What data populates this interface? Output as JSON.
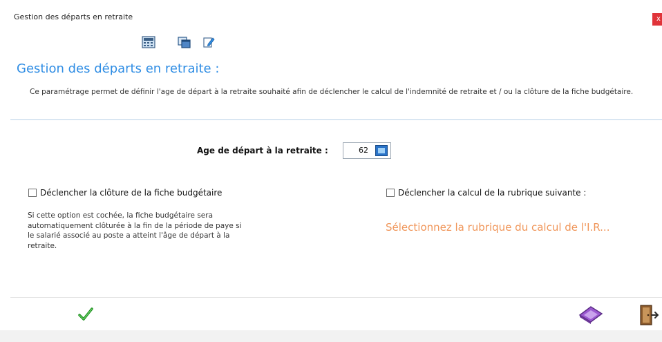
{
  "window": {
    "title": "Gestion des départs en retraite",
    "close_label": "x"
  },
  "toolbar": {
    "items": [
      {
        "icon": "calculator-icon"
      },
      {
        "icon": "windows-icon"
      },
      {
        "icon": "edit-icon"
      }
    ]
  },
  "main": {
    "heading": "Gestion des départs en retraite :",
    "description": "Ce paramétrage permet de définir l'age de départ à la retraite souhaité afin de déclencher le calcul de l'indemnité de retraite et / ou la clôture de la fiche budgétaire."
  },
  "age": {
    "label": "Age de départ à la retraite :",
    "value": "62"
  },
  "options": {
    "cloture": {
      "label": "Déclencher la clôture de la fiche budgétaire",
      "checked": false,
      "help": "Si cette option est cochée, la fiche budgétaire sera automatiquement clôturée à la fin de la période de paye si le salarié associé au poste a atteint l'âge de départ à la retraite."
    },
    "calcul": {
      "label": "Déclencher la calcul de la rubrique suivante :",
      "checked": false,
      "link_text": "Sélectionnez la rubrique du calcul de l'I.R..."
    }
  },
  "footer": {
    "validate_icon": "checkmark-icon",
    "clear_icon": "eraser-icon",
    "exit_icon": "exit-door-icon"
  },
  "colors": {
    "heading": "#2f8de4",
    "link": "#f0965a",
    "close": "#e0343a"
  }
}
